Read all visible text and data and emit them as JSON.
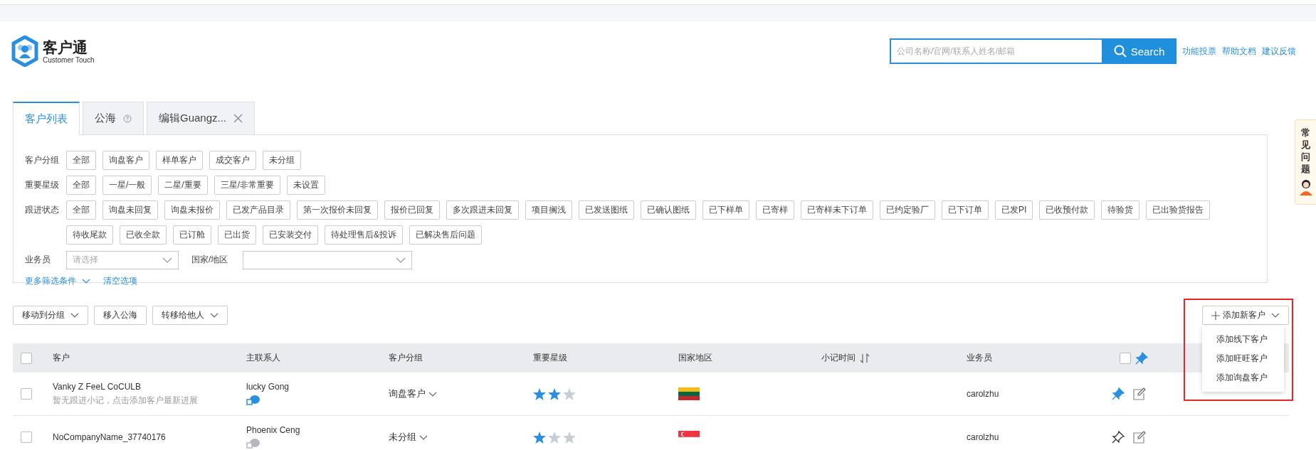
{
  "logo": {
    "title": "客户通",
    "subtitle": "Customer Touch"
  },
  "search": {
    "placeholder": "公司名称/官网/联系人姓名/邮箱",
    "button": "Search"
  },
  "header_links": [
    "功能投票",
    "帮助文档",
    "建议反馈"
  ],
  "tabs": [
    {
      "label": "客户列表",
      "selected": true,
      "help": false,
      "closable": false
    },
    {
      "label": "公海",
      "selected": false,
      "help": true,
      "closable": false
    },
    {
      "label": "编辑Guangz...",
      "selected": false,
      "help": false,
      "closable": true
    }
  ],
  "filters": [
    {
      "label": "客户分组",
      "options": [
        "全部",
        "询盘客户",
        "样单客户",
        "成交客户",
        "未分组"
      ]
    },
    {
      "label": "重要星级",
      "options": [
        "全部",
        "一星/一般",
        "二星/重要",
        "三星/非常重要",
        "未设置"
      ]
    },
    {
      "label": "跟进状态",
      "options": [
        "全部",
        "询盘未回复",
        "询盘未报价",
        "已发产品目录",
        "第一次报价未回复",
        "报价已回复",
        "多次跟进未回复",
        "项目搁浅",
        "已发送图纸",
        "已确认图纸",
        "已下样单",
        "已寄样",
        "已寄样未下订单",
        "已约定验厂",
        "已下订单",
        "已发PI",
        "已收预付款",
        "待验货",
        "已出验货报告",
        "待收尾款",
        "已收全款",
        "已订舱",
        "已出货",
        "已安装交付",
        "待处理售后&投诉",
        "已解决售后问题"
      ]
    }
  ],
  "selects": [
    {
      "label": "业务员",
      "placeholder": "请选择"
    },
    {
      "label": "国家/地区"
    }
  ],
  "filter_links": [
    {
      "label": "更多筛选条件",
      "caret": true
    },
    {
      "label": "清空选项",
      "caret": false
    }
  ],
  "help_tab": "常见问题",
  "actions": [
    {
      "label": "移动到分组",
      "caret": true
    },
    {
      "label": "移入公海",
      "caret": false
    },
    {
      "label": "转移给他人",
      "caret": true
    }
  ],
  "add_button": {
    "label": "添加新客户",
    "menu": [
      "添加线下客户",
      "添加旺旺客户",
      "添加询盘客户"
    ]
  },
  "table": {
    "header_checks": [
      {
        "checked": false
      },
      {
        "checked": false
      }
    ],
    "columns": [
      {
        "label": "客户",
        "sortable": false
      },
      {
        "label": "主联系人",
        "sortable": false
      },
      {
        "label": "客户分组",
        "sortable": false
      },
      {
        "label": "重要星级",
        "sortable": false
      },
      {
        "label": "国家地区",
        "sortable": false
      },
      {
        "label": "小记时间",
        "sortable": true
      },
      {
        "label": "业务员",
        "sortable": false
      }
    ],
    "rows": [
      {
        "checked": false,
        "customer": "Vanky Z FeeL CoCULB",
        "note": "暂无跟进小记，点击添加客户最新进展",
        "contact": "lucky Gong",
        "group": "询盘客户",
        "stars": 2,
        "flag": {
          "kind": "lt"
        },
        "chat_active": true,
        "salesperson": "carolzhu",
        "pinned": true
      },
      {
        "checked": false,
        "customer": "NoCompanyName_37740176",
        "contact": "Phoenix Ceng",
        "group": "未分组",
        "stars": 1,
        "flag": {
          "kind": "sg"
        },
        "chat_active": false,
        "salesperson": "carolzhu",
        "pinned": false
      }
    ]
  }
}
